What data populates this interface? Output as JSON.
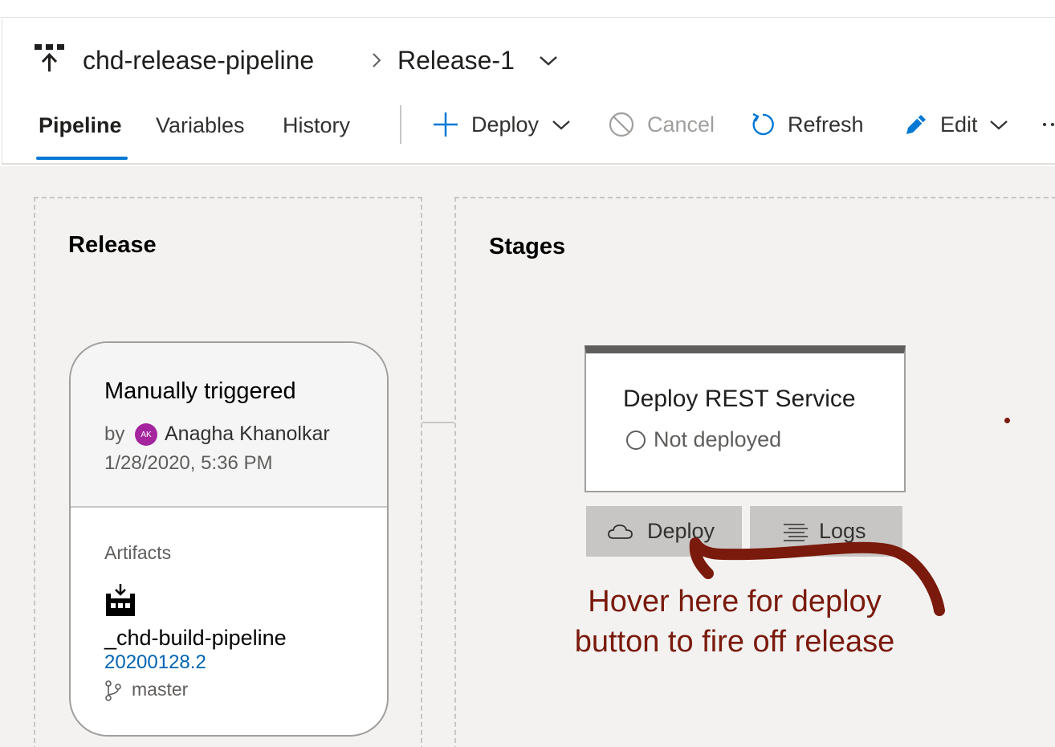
{
  "breadcrumb": {
    "pipeline_name": "chd-release-pipeline",
    "release_name": "Release-1"
  },
  "tabs": [
    {
      "label": "Pipeline",
      "active": true
    },
    {
      "label": "Variables",
      "active": false
    },
    {
      "label": "History",
      "active": false
    }
  ],
  "toolbar": {
    "deploy_label": "Deploy",
    "cancel_label": "Cancel",
    "refresh_label": "Refresh",
    "edit_label": "Edit",
    "more_label": "..."
  },
  "release_panel": {
    "title": "Release",
    "trigger": "Manually triggered",
    "by_label": "by",
    "avatar_initials": "AK",
    "user": "Anagha Khanolkar",
    "date": "1/28/2020, 5:36 PM",
    "artifacts_label": "Artifacts",
    "artifact_name": "_chd-build-pipeline",
    "artifact_version": "20200128.2",
    "branch": "master"
  },
  "stages_panel": {
    "title": "Stages",
    "stage_name": "Deploy REST Service",
    "stage_status": "Not deployed",
    "deploy_button": "Deploy",
    "logs_button": "Logs"
  },
  "annotation": {
    "line1": "Hover here for deploy",
    "line2": "button to fire off release"
  },
  "colors": {
    "accent": "#0078d4",
    "annotation": "#7a1a0c",
    "avatar": "#a4259e",
    "link": "#0063b1"
  }
}
